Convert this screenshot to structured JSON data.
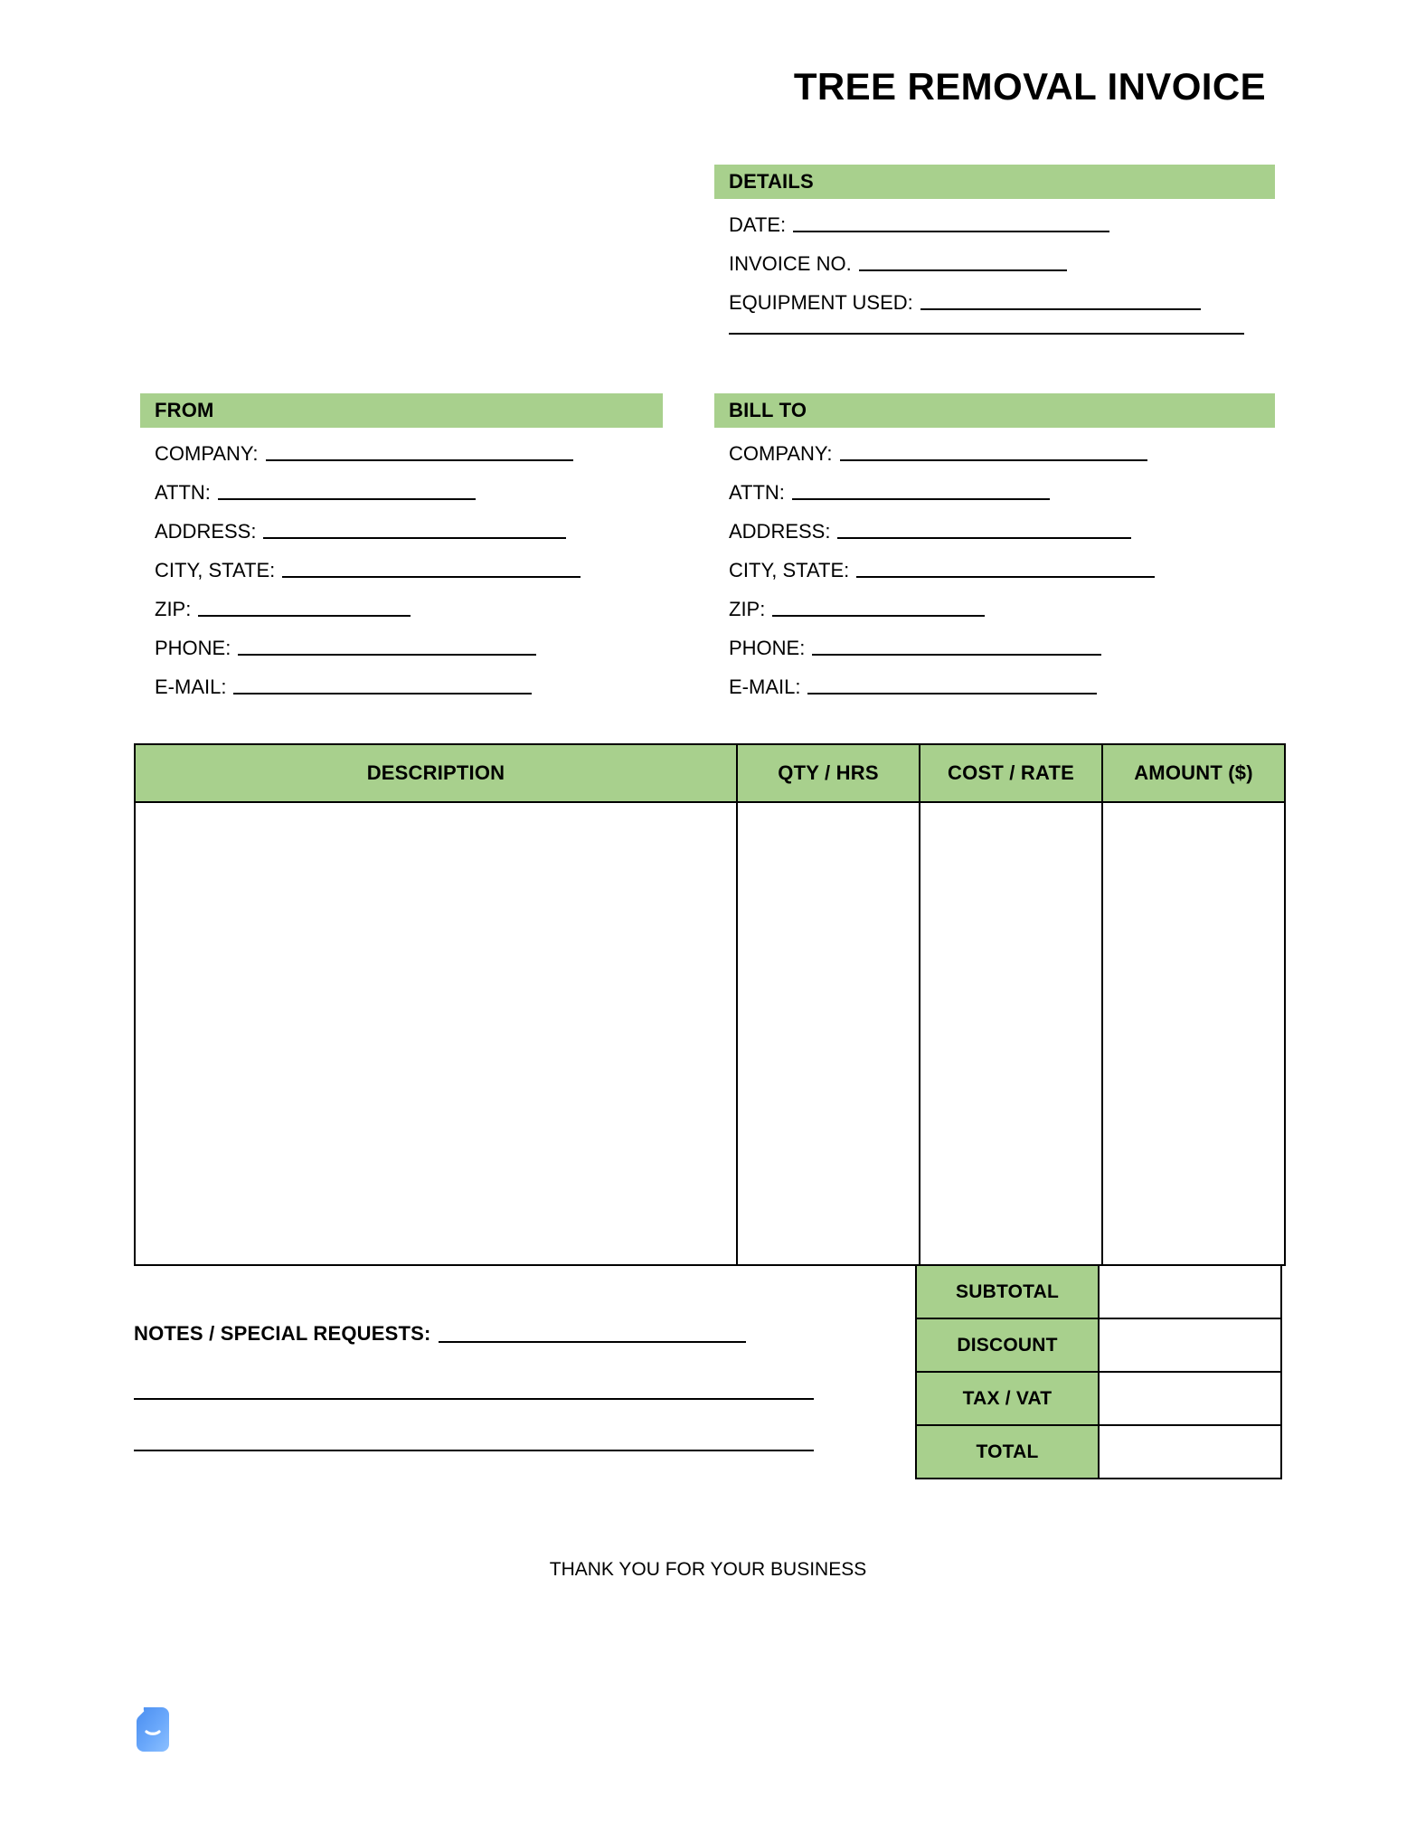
{
  "document": {
    "title": "TREE REMOVAL INVOICE",
    "footer_note": "THANK YOU FOR YOUR BUSINESS"
  },
  "colors": {
    "accent_green": "#a8d08d",
    "rule": "#000000",
    "logo_blue": "#5b9bf8"
  },
  "details": {
    "heading": "DETAILS",
    "fields": [
      {
        "label": "DATE:",
        "value": ""
      },
      {
        "label": "INVOICE NO.",
        "value": ""
      },
      {
        "label": "EQUIPMENT USED:",
        "value": ""
      }
    ]
  },
  "from": {
    "heading": "FROM",
    "fields": [
      {
        "label": "COMPANY:",
        "value": ""
      },
      {
        "label": "ATTN:",
        "value": ""
      },
      {
        "label": "ADDRESS:",
        "value": ""
      },
      {
        "label": "CITY, STATE:",
        "value": ""
      },
      {
        "label": "ZIP:",
        "value": ""
      },
      {
        "label": "PHONE:",
        "value": ""
      },
      {
        "label": "E-MAIL:",
        "value": ""
      }
    ]
  },
  "bill_to": {
    "heading": "BILL TO",
    "fields": [
      {
        "label": "COMPANY:",
        "value": ""
      },
      {
        "label": "ATTN:",
        "value": ""
      },
      {
        "label": "ADDRESS:",
        "value": ""
      },
      {
        "label": "CITY, STATE:",
        "value": ""
      },
      {
        "label": "ZIP:",
        "value": ""
      },
      {
        "label": "PHONE:",
        "value": ""
      },
      {
        "label": "E-MAIL:",
        "value": ""
      }
    ]
  },
  "line_items": {
    "columns": [
      "DESCRIPTION",
      "QTY / HRS",
      "COST / RATE",
      "AMOUNT ($)"
    ],
    "rows": []
  },
  "totals": {
    "rows": [
      {
        "label": "SUBTOTAL",
        "value": ""
      },
      {
        "label": "DISCOUNT",
        "value": ""
      },
      {
        "label": "TAX / VAT",
        "value": ""
      },
      {
        "label": "TOTAL",
        "value": ""
      }
    ]
  },
  "notes": {
    "label": "NOTES / SPECIAL REQUESTS:",
    "value": ""
  },
  "logo": {
    "icon": "document-smile-icon"
  }
}
